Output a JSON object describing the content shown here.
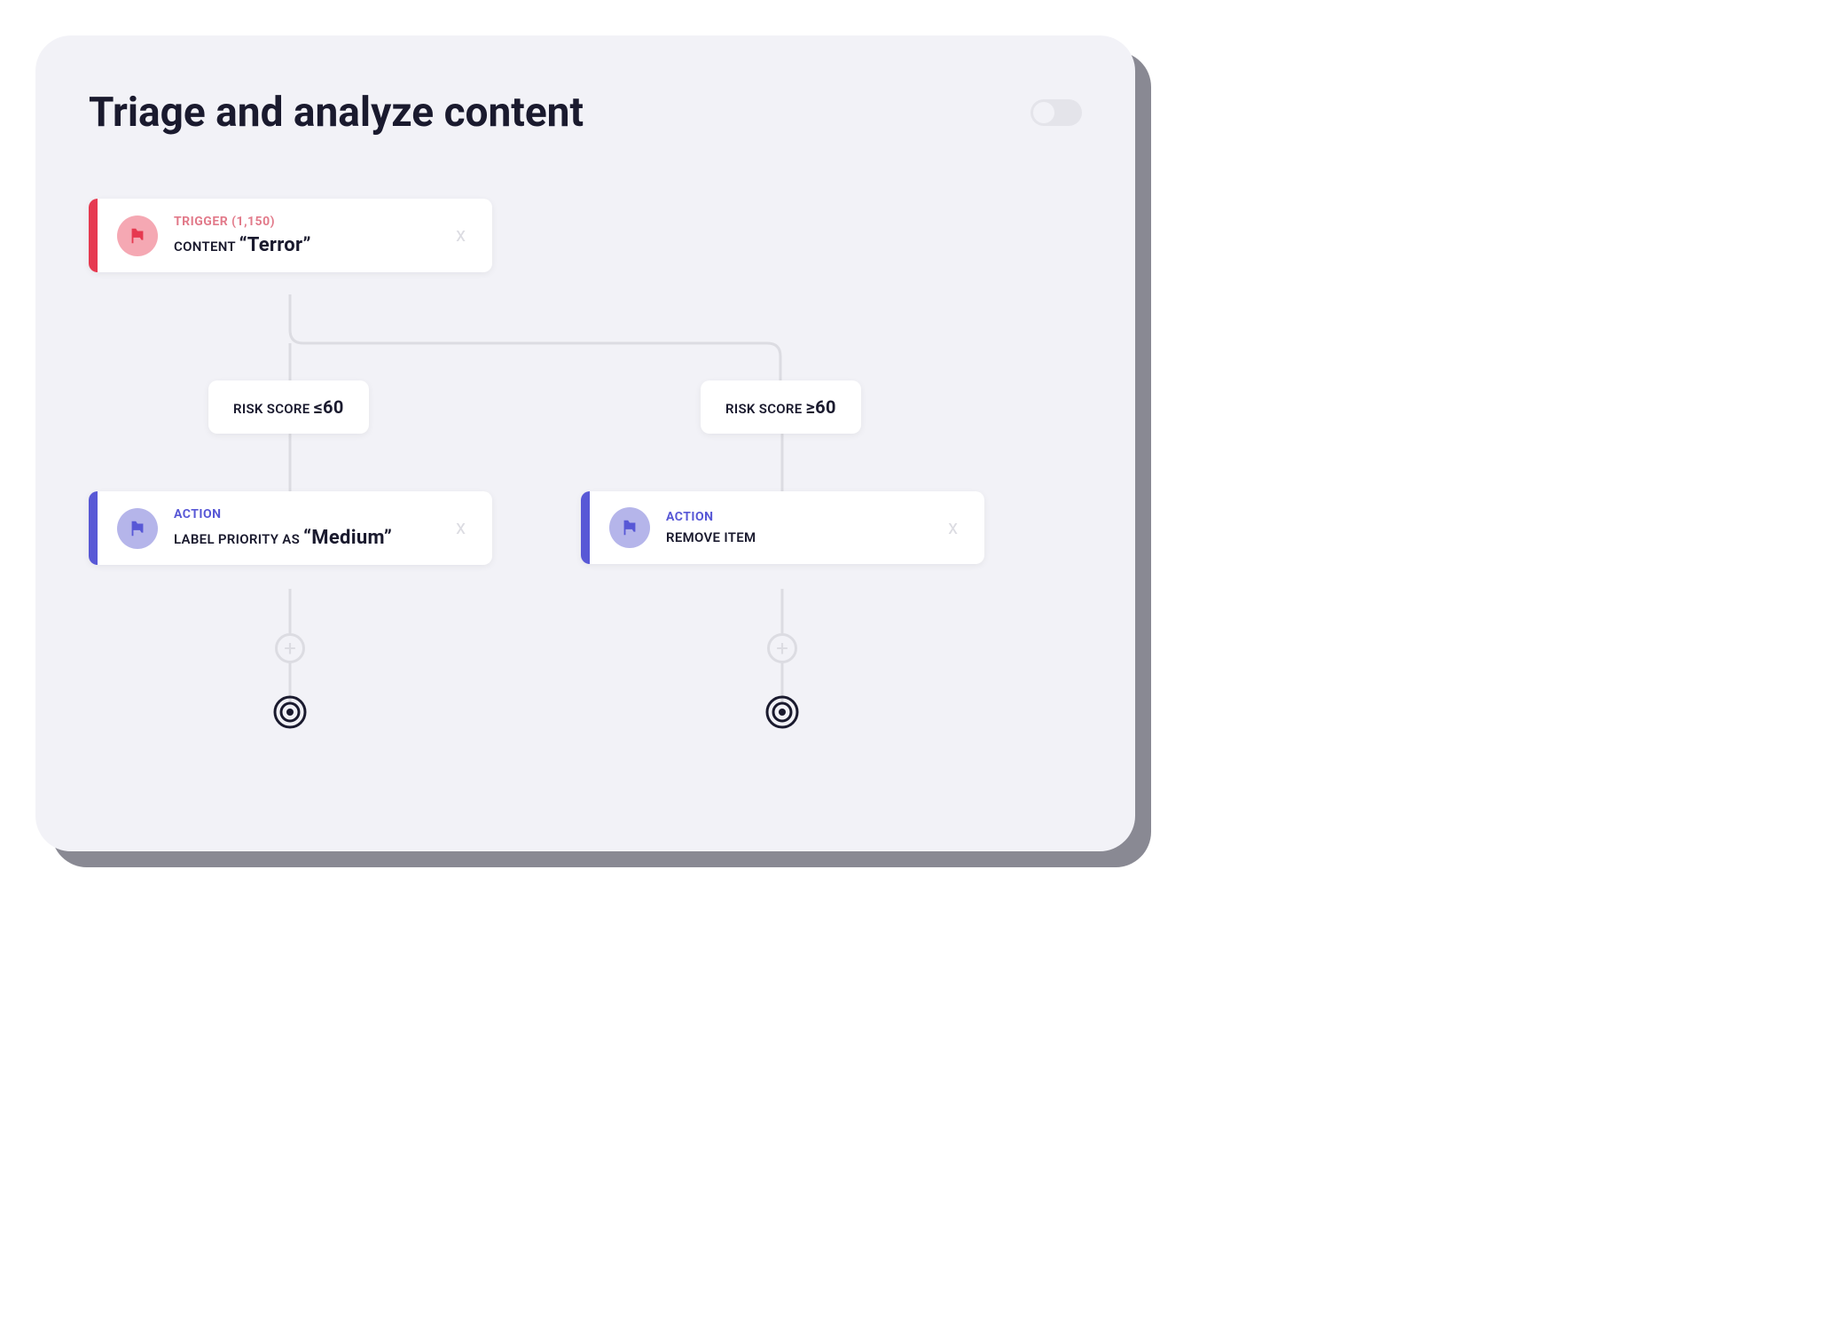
{
  "header": {
    "title": "Triage and analyze content"
  },
  "trigger": {
    "label": "TRIGGER (1,150)",
    "content_prefix": "CONTENT ",
    "content_value": "“Terror”"
  },
  "conditions": {
    "left": {
      "prefix": "RISK SCORE ",
      "op": "≤60"
    },
    "right": {
      "prefix": "RISK SCORE ",
      "op": "≥60"
    }
  },
  "actions": {
    "left": {
      "label": "ACTION",
      "content_prefix": "LABEL PRIORITY AS ",
      "content_value": "“Medium”"
    },
    "right": {
      "label": "ACTION",
      "content": "REMOVE ITEM"
    }
  },
  "glyphs": {
    "close": "x",
    "plus": "+"
  },
  "colors": {
    "panel_bg": "#f2f2f7",
    "accent_red": "#e63950",
    "accent_blue": "#5858d6",
    "connector": "#dcdce2"
  }
}
